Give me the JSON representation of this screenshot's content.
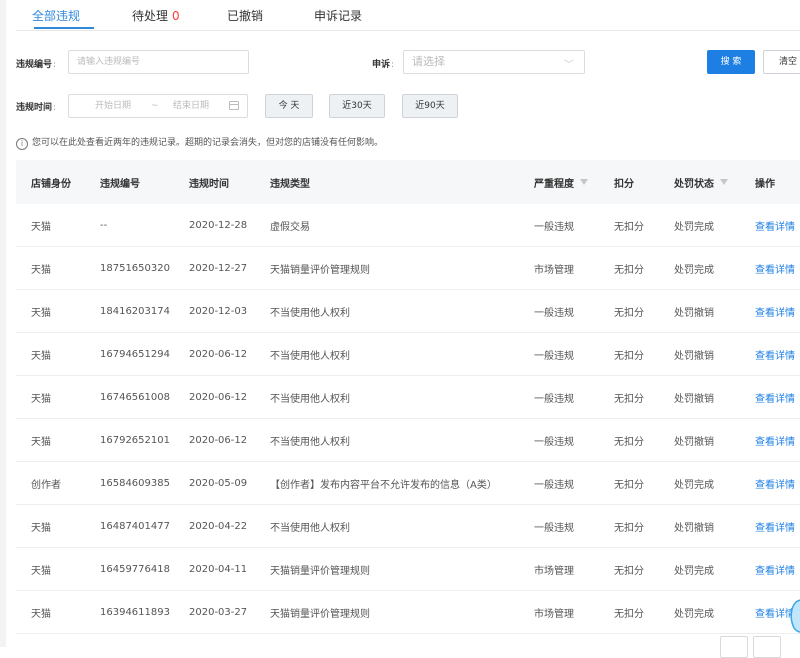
{
  "tabs": [
    {
      "label": "全部违规",
      "active": true
    },
    {
      "label": "待处理",
      "count": "0"
    },
    {
      "label": "已撤销"
    },
    {
      "label": "申诉记录"
    }
  ],
  "filters": {
    "violation_no_label": "违规编号",
    "violation_no_placeholder": "请输入违规编号",
    "appeal_label": "申诉",
    "appeal_placeholder": "请选择",
    "search_btn": "搜 索",
    "clear_btn": "清空",
    "time_label": "违规时间",
    "start_placeholder": "开始日期",
    "range_sep": "~",
    "end_placeholder": "结束日期",
    "today_btn": "今 天",
    "d30_btn": "近30天",
    "d90_btn": "近90天"
  },
  "notice": "您可以在此处查看近两年的违规记录。超期的记录会消失，但对您的店铺没有任何影响。",
  "table": {
    "headers": [
      "店铺身份",
      "违规编号",
      "违规时间",
      "违规类型",
      "严重程度",
      "扣分",
      "处罚状态",
      "操作"
    ],
    "rows": [
      [
        "天猫",
        "--",
        "2020-12-28",
        "虚假交易",
        "一般违规",
        "无扣分",
        "处罚完成",
        "查看详情"
      ],
      [
        "天猫",
        "18751650320",
        "2020-12-27",
        "天猫销量评价管理规则",
        "市场管理",
        "无扣分",
        "处罚完成",
        "查看详情"
      ],
      [
        "天猫",
        "18416203174",
        "2020-12-03",
        "不当使用他人权利",
        "一般违规",
        "无扣分",
        "处罚撤销",
        "查看详情"
      ],
      [
        "天猫",
        "16794651294",
        "2020-06-12",
        "不当使用他人权利",
        "一般违规",
        "无扣分",
        "处罚撤销",
        "查看详情"
      ],
      [
        "天猫",
        "16746561008",
        "2020-06-12",
        "不当使用他人权利",
        "一般违规",
        "无扣分",
        "处罚撤销",
        "查看详情"
      ],
      [
        "天猫",
        "16792652101",
        "2020-06-12",
        "不当使用他人权利",
        "一般违规",
        "无扣分",
        "处罚撤销",
        "查看详情"
      ],
      [
        "创作者",
        "16584609385",
        "2020-05-09",
        "【创作者】发布内容平台不允许发布的信息（A类）",
        "一般违规",
        "无扣分",
        "处罚完成",
        "查看详情"
      ],
      [
        "天猫",
        "16487401477",
        "2020-04-22",
        "不当使用他人权利",
        "一般违规",
        "无扣分",
        "处罚撤销",
        "查看详情"
      ],
      [
        "天猫",
        "16459776418",
        "2020-04-11",
        "天猫销量评价管理规则",
        "市场管理",
        "无扣分",
        "处罚完成",
        "查看详情"
      ],
      [
        "天猫",
        "16394611893",
        "2020-03-27",
        "天猫销量评价管理规则",
        "市场管理",
        "无扣分",
        "处罚完成",
        "查看详情"
      ]
    ]
  },
  "colors": {
    "accent": "#1d7fe4",
    "tab_active": "#3089dc",
    "count_red": "#ff3b30"
  }
}
